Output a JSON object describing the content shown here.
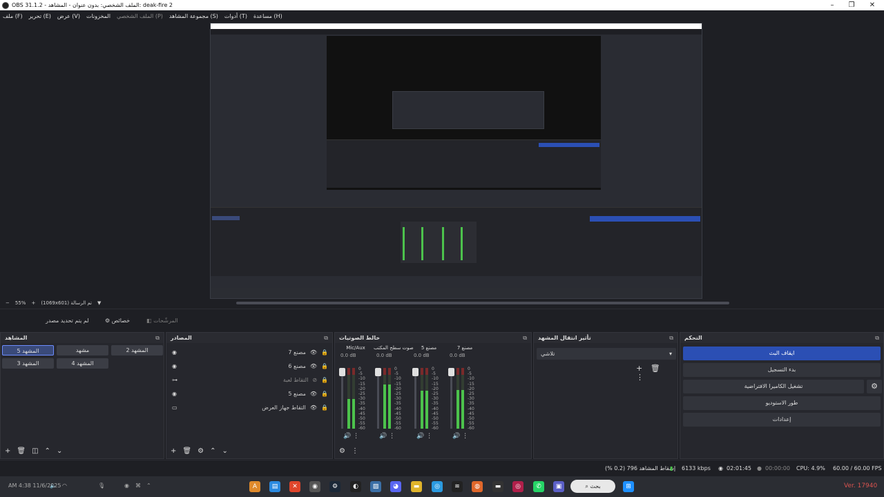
{
  "window": {
    "title": "OBS 31.1.2 - الملف الشخصي: بدون عنوان - المشاهد: deak-fire 2"
  },
  "menu": {
    "items": [
      "ملف (F)",
      "تحرير (E)",
      "عرض (V)",
      "المخزونات",
      "الملف الشخصي (P)",
      "مجموعة المشاهد (S)",
      "أدوات (T)",
      "مساعدة (H)"
    ]
  },
  "zoom": {
    "level": "55%",
    "resolution": "(1069x601) تم الرسالة"
  },
  "source_toolbar": {
    "no_source": "لم يتم تحديد مصدر",
    "properties": "خصائص",
    "filters": "المرشّحات"
  },
  "scenes": {
    "title": "المشاهد",
    "items": [
      "المشهد 2",
      "مشهد",
      "المشهد 5",
      "المشهد 4",
      "المشهد 3"
    ],
    "active": "المشهد 5"
  },
  "sources": {
    "title": "المصادر",
    "items": [
      {
        "label": "مصنع 7",
        "icon": "browser-icon",
        "muted": false
      },
      {
        "label": "مصنع 6",
        "icon": "browser-icon",
        "muted": false
      },
      {
        "label": "التقاط لعبة",
        "icon": "gamepad-icon",
        "muted": true
      },
      {
        "label": "مصنع 5",
        "icon": "browser-icon",
        "muted": false
      },
      {
        "label": "التقاط جهاز العرض",
        "icon": "monitor-icon",
        "muted": false
      }
    ]
  },
  "mixer": {
    "title": "خالط الصوتيات",
    "channels": [
      {
        "name": "Mic/Aux",
        "db": "0.0 dB",
        "level": 0.55
      },
      {
        "name": "صوت سطح المكتب",
        "db": "0.0 dB",
        "level": 0.82
      },
      {
        "name": "مصنع 5",
        "db": "0.0 dB",
        "level": 0.7
      },
      {
        "name": "مصنع 7",
        "db": "0.0 dB",
        "level": 0.72
      }
    ],
    "ticks": [
      "0",
      "-5",
      "-10",
      "-15",
      "-20",
      "-25",
      "-30",
      "-35",
      "-40",
      "-45",
      "-50",
      "-55",
      "-60"
    ]
  },
  "transitions": {
    "title": "تأثير انتقال المشهد",
    "selected": "تلاشي"
  },
  "controls": {
    "title": "التحكم",
    "stop_stream": "ايقاف البث",
    "start_record": "بدء التسجيل",
    "virtual_cam": "تشغيل الكاميرا الافتراضية",
    "studio_mode": "طور الاستوديو",
    "settings": "إعدادات"
  },
  "status": {
    "dropped": "إسقاط المشاهد 796 (0.2 %)",
    "bitrate": "6133 kbps",
    "stream_time": "02:01:45",
    "rec_time": "00:00:00",
    "cpu": "CPU: 4.9%",
    "fps": "60.00 / 60.00 FPS"
  },
  "taskbar": {
    "search": "بحث",
    "tray_time": "AM 4:38\n11/6/2025",
    "version": "Ver. 17940"
  },
  "colors": {
    "accent": "#2b4fb4",
    "meter_green": "#4cc24c"
  }
}
